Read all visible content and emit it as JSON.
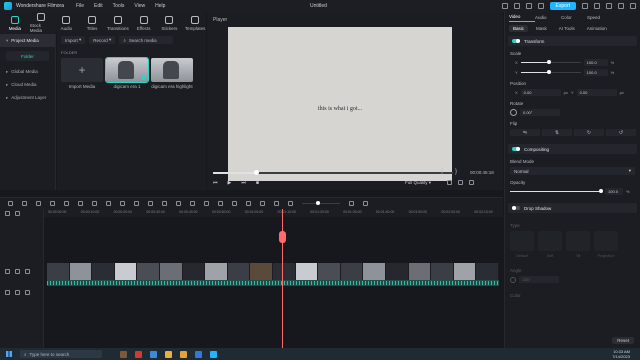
{
  "titlebar": {
    "app_name": "Wondershare Filmora",
    "menu": [
      "File",
      "Edit",
      "Tools",
      "View",
      "Help"
    ],
    "document": "Untitled",
    "export_label": "Export"
  },
  "media_toolbar": [
    {
      "label": "Media",
      "icon": "media-icon"
    },
    {
      "label": "Stock Media",
      "icon": "stock-media-icon"
    },
    {
      "label": "Audio",
      "icon": "audio-icon"
    },
    {
      "label": "Titles",
      "icon": "titles-icon"
    },
    {
      "label": "Transitions",
      "icon": "transitions-icon"
    },
    {
      "label": "Effects",
      "icon": "effects-icon"
    },
    {
      "label": "Stickers",
      "icon": "stickers-icon"
    },
    {
      "label": "Templates",
      "icon": "templates-icon"
    }
  ],
  "left_nav": {
    "items": [
      "Project Media",
      "Global Media",
      "Cloud Media",
      "Adjustment Layer"
    ],
    "folder_button": "Folder"
  },
  "media_panel": {
    "import_label": "Import",
    "record_label": "Record",
    "search_placeholder": "Search media",
    "folder_label": "FOLDER",
    "tiles": [
      {
        "label": "Import Media"
      },
      {
        "label": "digicam era 1"
      },
      {
        "label": "digicam era highlight"
      }
    ]
  },
  "player": {
    "title": "Player",
    "caption": "this is what i got...",
    "progress": 0.18,
    "timecode": "00:00:45:18",
    "quality": "Full Quality"
  },
  "inspector": {
    "tabs": [
      "Video",
      "Audio",
      "Color",
      "Speed"
    ],
    "subtabs": [
      "Basic",
      "Mask",
      "AI Tools",
      "Animation"
    ],
    "transform": "Transform",
    "scale_label": "Scale",
    "scale_x": "100.0",
    "scale_y": "100.0",
    "unit_pct": "%",
    "x": "X",
    "y": "Y",
    "position_label": "Position",
    "pos_x": "0.00",
    "pos_y": "0.00",
    "unit_px": "px",
    "rotate_label": "Rotate",
    "rotate_value": "0.00°",
    "flip_label": "Flip",
    "compositing": "Compositing",
    "blend_label": "Blend Mode",
    "blend_value": "Normal",
    "opacity_label": "Opacity",
    "opacity_value": "100.0",
    "drop_shadow": "Drop Shadow",
    "type_label": "Type",
    "preset_labels": [
      "Default",
      "Soft",
      "Tilt",
      "Projection"
    ],
    "angle_label": "Angle",
    "angle_value": "135°",
    "color_label": "Color",
    "reset_label": "Reset"
  },
  "timeline": {
    "ticks": [
      "00:00:00:00",
      "00:00:10:00",
      "00:00:20:00",
      "00:00:30:00",
      "00:00:40:00",
      "00:00:50:00",
      "00:01:00:00",
      "00:01:10:00",
      "00:01:20:00",
      "00:01:30:00",
      "00:01:40:00",
      "00:01:50:00",
      "00:02:00:00",
      "00:02:10:00"
    ]
  },
  "taskbar": {
    "search_placeholder": "Type here to search",
    "time": "10:33 AM",
    "date": "7/14/2023"
  },
  "colors": {
    "accent": "#2ed3c4",
    "export": "#1fb6ff",
    "playhead": "#ff6b6b"
  }
}
